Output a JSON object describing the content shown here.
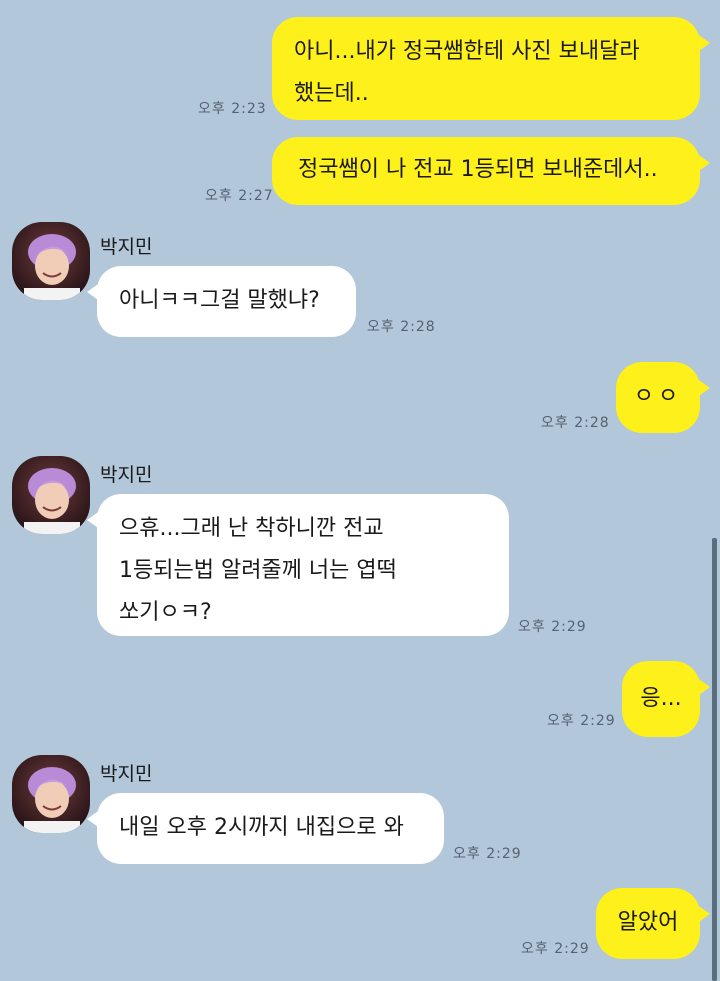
{
  "messages": {
    "m1": {
      "text": "아니...내가 정국쌤한테 사진 보내달라\n했는데..",
      "time": "오후 2:23"
    },
    "m2": {
      "text": "정국쌤이 나 전교 1등되면 보내준데서..",
      "time": "오후 2:27"
    },
    "m3": {
      "sender": "박지민",
      "text": "아니ㅋㅋ그걸 말했냐?",
      "time": "오후 2:28"
    },
    "m4": {
      "text": "ㅇㅇ",
      "time": "오후 2:28"
    },
    "m5": {
      "sender": "박지민",
      "text": "으휴...그래 난 착하니깐 전교\n1등되는법 알려줄께 너는 엽떡\n쏘기ㅇㅋ?",
      "time": "오후 2:29"
    },
    "m6": {
      "text": "응...",
      "time": "오후 2:29"
    },
    "m7": {
      "sender": "박지민",
      "text": "내일 오후 2시까지 내집으로 와",
      "time": "오후 2:29"
    },
    "m8": {
      "text": "알았어",
      "time": "오후 2:29"
    }
  },
  "colors": {
    "background": "#b2c7da",
    "my_bubble": "#fef01b",
    "their_bubble": "#ffffff"
  },
  "icons": {
    "avatar": "profile-photo"
  }
}
